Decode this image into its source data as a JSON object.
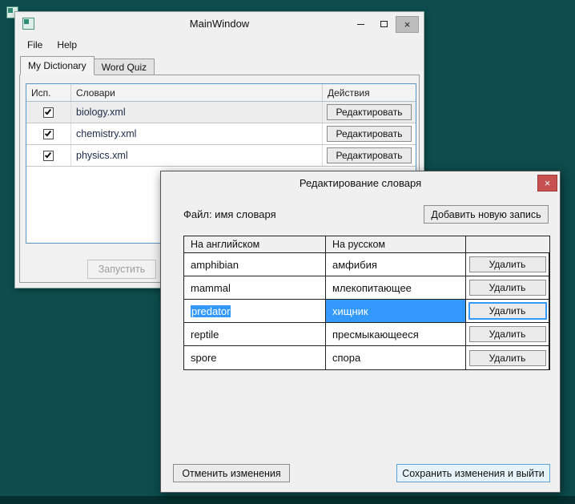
{
  "colors": {
    "desktop-bg": "#0d4d4d",
    "taskbar-bg": "#05302f",
    "window-bg": "#f0f0f0",
    "accent": "#3399ff",
    "close-red": "#c75050"
  },
  "icons": {
    "close": "×",
    "minimize": "–",
    "maximize": "□",
    "check": "✓"
  },
  "main_window": {
    "title": "MainWindow",
    "menu": [
      "File",
      "Help"
    ],
    "tabs": [
      {
        "label": "My Dictionary",
        "active": true
      },
      {
        "label": "Word Quiz",
        "active": false
      }
    ],
    "table": {
      "headers": [
        "Исп.",
        "Словари",
        "Действия"
      ],
      "rows": [
        {
          "checked": true,
          "file": "biology.xml",
          "action": "Редактировать"
        },
        {
          "checked": true,
          "file": "chemistry.xml",
          "action": "Редактировать"
        },
        {
          "checked": true,
          "file": "physics.xml",
          "action": "Редактировать"
        }
      ]
    },
    "run_button": {
      "label": "Запустить",
      "enabled": false
    }
  },
  "dialog": {
    "title": "Редактирование словаря",
    "file_label": "Файл: имя словаря",
    "add_button": "Добавить новую запись",
    "table": {
      "headers": [
        "На английском",
        "На русском",
        ""
      ],
      "rows": [
        {
          "en": "amphibian",
          "ru": "амфибия",
          "action": "Удалить",
          "selected": false
        },
        {
          "en": "mammal",
          "ru": "млекопитающее",
          "action": "Удалить",
          "selected": false
        },
        {
          "en": "predator",
          "ru": "хищник",
          "action": "Удалить",
          "selected": true
        },
        {
          "en": "reptile",
          "ru": "пресмыкающееся",
          "action": "Удалить",
          "selected": false
        },
        {
          "en": "spore",
          "ru": "спора",
          "action": "Удалить",
          "selected": false
        }
      ]
    },
    "cancel_button": "Отменить изменения",
    "save_button": "Сохранить изменения и выйти"
  }
}
